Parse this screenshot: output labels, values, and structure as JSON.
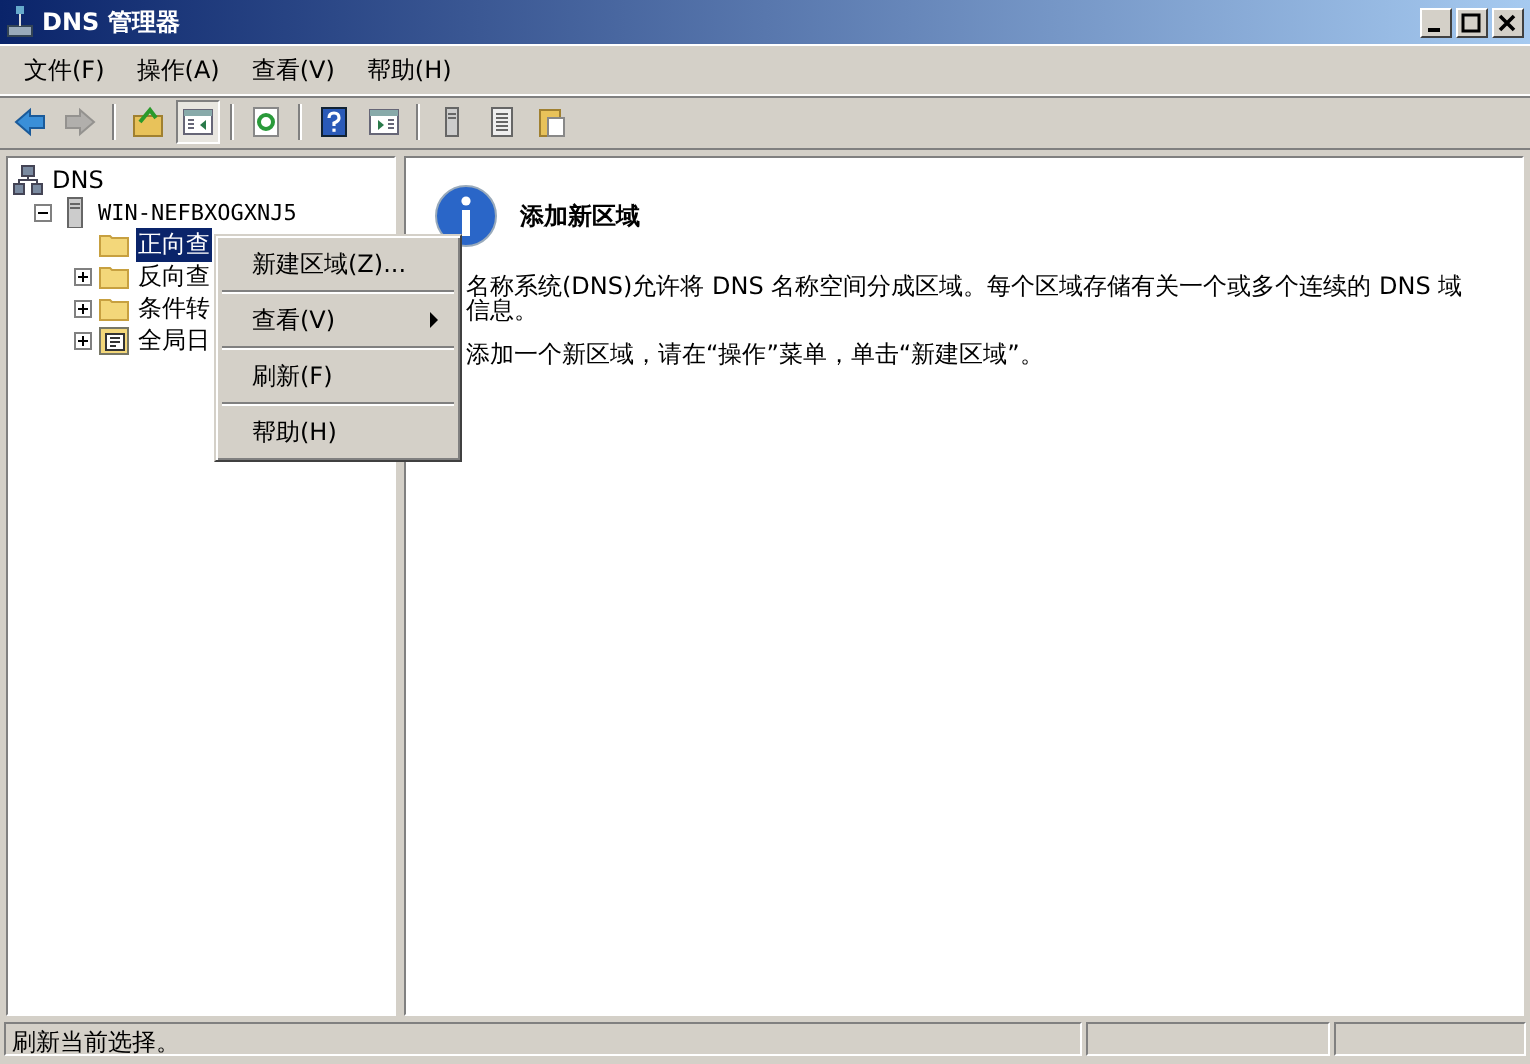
{
  "window": {
    "title": "DNS 管理器"
  },
  "menu_bar": [
    "文件(F)",
    "操作(A)",
    "查看(V)",
    "帮助(H)"
  ],
  "toolbar": [
    {
      "kind": "back",
      "disabled": false
    },
    {
      "kind": "forward",
      "disabled": true
    },
    {
      "kind": "separator"
    },
    {
      "kind": "up",
      "disabled": false
    },
    {
      "kind": "tree",
      "pressed": true
    },
    {
      "kind": "separator"
    },
    {
      "kind": "refresh",
      "disabled": false
    },
    {
      "kind": "separator"
    },
    {
      "kind": "help",
      "disabled": false
    },
    {
      "kind": "pane",
      "pressed": false
    },
    {
      "kind": "separator"
    },
    {
      "kind": "server",
      "disabled": false
    },
    {
      "kind": "list",
      "disabled": false
    },
    {
      "kind": "paste",
      "disabled": false
    }
  ],
  "tree": [
    {
      "label": "DNS",
      "kind": "dns",
      "selected": false,
      "children": [
        {
          "label": "WIN-NEFBXOGXNJ5",
          "kind": "server",
          "selected": false,
          "expanded": true,
          "children": [
            {
              "label": "正向查",
              "kind": "folder",
              "selected": true
            },
            {
              "label": "反向查",
              "kind": "folder",
              "selected": false,
              "expanded": false
            },
            {
              "label": "条件转",
              "kind": "folder",
              "selected": false,
              "expanded": false
            },
            {
              "label": "全局日",
              "kind": "log",
              "selected": false,
              "expanded": false
            }
          ]
        }
      ]
    }
  ],
  "context_menu": [
    {
      "kind": "item",
      "label": "新建区域(Z)...",
      "submenu": false
    },
    {
      "kind": "separator"
    },
    {
      "kind": "item",
      "label": "查看(V)",
      "submenu": true
    },
    {
      "kind": "separator"
    },
    {
      "kind": "item",
      "label": "刷新(F)",
      "submenu": false
    },
    {
      "kind": "separator"
    },
    {
      "kind": "item",
      "label": "帮助(H)",
      "submenu": false
    }
  ],
  "content": {
    "heading": "添加新区域",
    "paragraphs": [
      "名称系统(DNS)允许将 DNS 名称空间分成区域。每个区域存储有关一个或多个连续的 DNS 域信息。",
      "添加一个新区域，请在“操作”菜单，单击“新建区域”。"
    ]
  },
  "status_bar": {
    "text": "刷新当前选择。"
  }
}
